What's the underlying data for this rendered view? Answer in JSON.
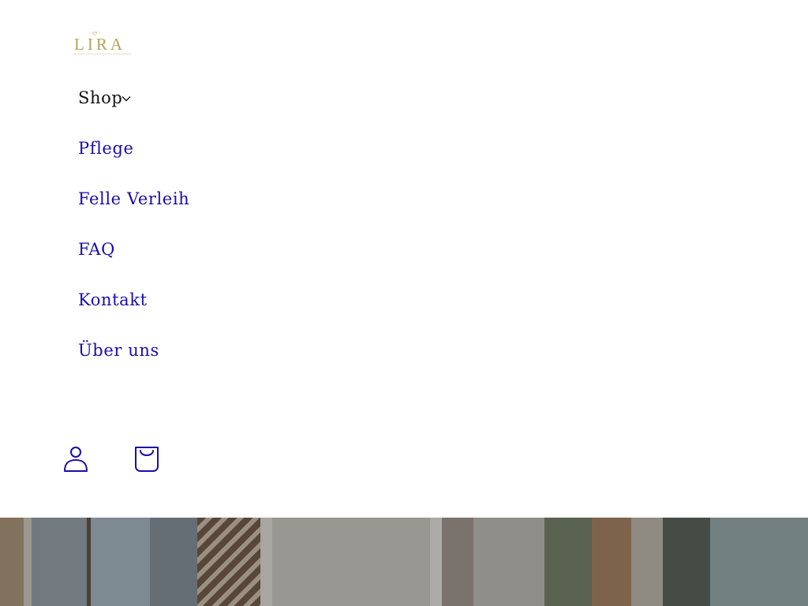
{
  "brand": {
    "name": "LIRA",
    "logo_color": "#b9a05a",
    "logo_icon": "crown-icon"
  },
  "nav": {
    "items": [
      {
        "label": "Shop",
        "has_dropdown": true,
        "icon": "chevron-down-icon"
      },
      {
        "label": "Pflege"
      },
      {
        "label": "Felle Verleih"
      },
      {
        "label": "FAQ"
      },
      {
        "label": "Kontakt"
      },
      {
        "label": "Über uns"
      }
    ],
    "link_color": "#1a0dab",
    "active_color": "#111111"
  },
  "header_icons": [
    {
      "name": "account-icon"
    },
    {
      "name": "cart-icon"
    }
  ],
  "hero": {
    "image": "interior-photo"
  }
}
